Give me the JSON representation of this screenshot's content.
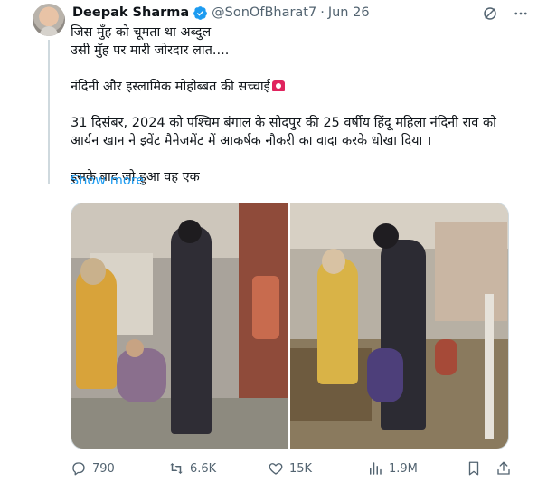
{
  "tweet": {
    "author_name": "Deepak Sharma",
    "handle": "@SonOfBharat7",
    "separator": "·",
    "date": "Jun 26",
    "lines": [
      "जिस मुँह को चूमता था अब्दुल",
      "उसी मुँह पर मारी जोरदार लात...."
    ],
    "headline": "नंदिनी और इस्लामिक मोहोब्बत की सच्चाई",
    "paragraph_lines": [
      "31 दिसंबर, 2024 को पश्चिम बंगाल के सोदपुर की 25 वर्षीय हिंदू महिला नंदिनी राव को",
      "आर्यन खान ने इवेंट मैनेजमेंट में आकर्षक नौकरी का वादा करके धोखा दिया ।"
    ],
    "trailing": "इसके बाद जो हुआ वह एक",
    "show_more": "Show more"
  },
  "stats": {
    "replies": "790",
    "reposts": "6.6K",
    "likes": "15K",
    "views": "1.9M"
  },
  "colors": {
    "accent": "#1d9bf0",
    "muted": "#536471",
    "text": "#0f1419",
    "border": "#cfd9de"
  },
  "icons": {
    "verified": "verified-badge-icon",
    "grok": "grok-icon",
    "more": "more-icon",
    "reply": "reply-icon",
    "repost": "repost-icon",
    "like": "heart-icon",
    "views": "views-icon",
    "bookmark": "bookmark-icon",
    "share": "share-icon",
    "siren": "siren-emoji"
  }
}
